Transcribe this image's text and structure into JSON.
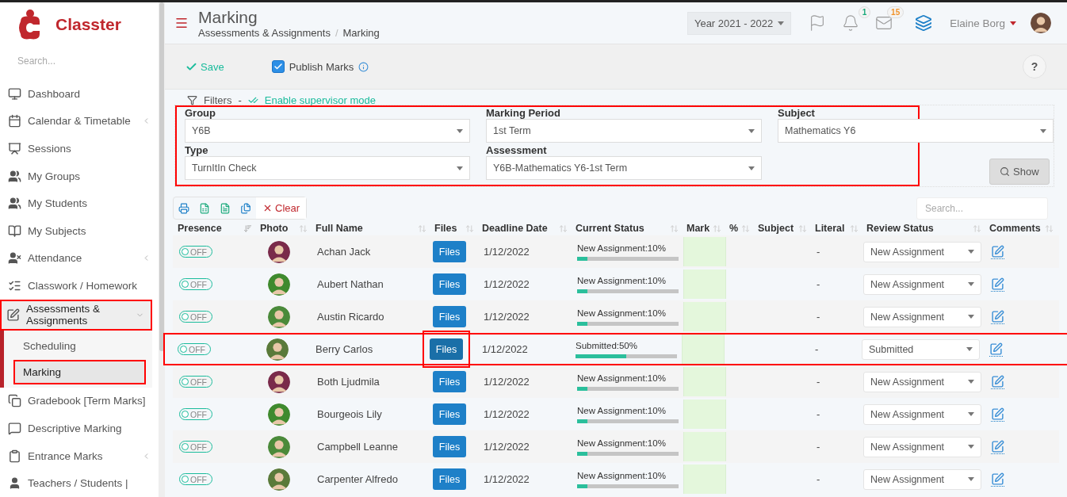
{
  "app": {
    "logo": "Classter"
  },
  "sidebar": {
    "search_placeholder": "Search...",
    "items": [
      {
        "label": "Dashboard",
        "kind": "link",
        "selected": false,
        "highlighted": false
      },
      {
        "label": "Calendar & Timetable",
        "kind": "group",
        "expanded": false,
        "selected": false,
        "highlighted": false
      },
      {
        "label": "Sessions",
        "kind": "link",
        "selected": false,
        "highlighted": false
      },
      {
        "label": "My Groups",
        "kind": "link",
        "selected": false,
        "highlighted": false
      },
      {
        "label": "My Students",
        "kind": "link",
        "selected": false,
        "highlighted": false
      },
      {
        "label": "My Subjects",
        "kind": "link",
        "selected": false,
        "highlighted": false
      },
      {
        "label": "Attendance",
        "kind": "group",
        "expanded": false,
        "selected": false,
        "highlighted": false
      },
      {
        "label": "Classwork / Homework",
        "kind": "link",
        "selected": false,
        "highlighted": false
      },
      {
        "label": "Assessments & Assignments",
        "kind": "group",
        "expanded": true,
        "selected": false,
        "highlighted": true,
        "children": [
          {
            "label": "Scheduling",
            "selected": false,
            "highlighted": false
          },
          {
            "label": "Marking",
            "selected": true,
            "highlighted": true
          }
        ]
      },
      {
        "label": "Gradebook [Term Marks]",
        "kind": "link",
        "selected": false,
        "highlighted": false
      },
      {
        "label": "Descriptive Marking",
        "kind": "link",
        "selected": false,
        "highlighted": false
      },
      {
        "label": "Entrance Marks",
        "kind": "group",
        "expanded": false,
        "selected": false,
        "highlighted": false
      },
      {
        "label": "Teachers / Students |",
        "kind": "link",
        "selected": false,
        "highlighted": false
      }
    ]
  },
  "header": {
    "title": "Marking",
    "breadcrumb": [
      "Assessments & Assignments",
      "Marking"
    ],
    "breadcrumb_separator": "/",
    "year": "Year 2021 - 2022",
    "notifications": "1",
    "messages": "15",
    "user": "Elaine Borg"
  },
  "toolbar": {
    "save": "Save",
    "publish": {
      "label": "Publish Marks",
      "checked": true
    },
    "help": "?"
  },
  "filters": {
    "title": "Filters",
    "separator": "-",
    "supervisor": "Enable supervisor mode",
    "highlighted": true,
    "fields": [
      {
        "label": "Group",
        "value": "Y6B"
      },
      {
        "label": "Marking Period",
        "value": "1st Term"
      },
      {
        "label": "Subject",
        "value": "Mathematics Y6"
      },
      {
        "label": "Type",
        "value": "TurnItIn Check"
      },
      {
        "label": "Assessment",
        "value": "Y6B-Mathematics Y6-1st Term"
      }
    ],
    "show": "Show"
  },
  "table": {
    "clear": "Clear",
    "search_placeholder": "Search...",
    "columns": [
      "Presence",
      "Photo",
      "Full Name",
      "Files",
      "Deadline Date",
      "Current Status",
      "Mark",
      "%",
      "Subject",
      "Literal",
      "Review Status",
      "Comments"
    ],
    "rows": [
      {
        "presence": "OFF",
        "on": false,
        "name": "Achan Jack",
        "files": "Files",
        "deadline": "1/12/2022",
        "status": "New Assignment:10%",
        "level": 0.1,
        "literal": "-",
        "review": "New Assignment",
        "highlighted": false,
        "files_highlighted": false
      },
      {
        "presence": "OFF",
        "on": false,
        "name": "Aubert Nathan",
        "files": "Files",
        "deadline": "1/12/2022",
        "status": "New Assignment:10%",
        "level": 0.1,
        "literal": "-",
        "review": "New Assignment",
        "highlighted": false,
        "files_highlighted": false
      },
      {
        "presence": "OFF",
        "on": false,
        "name": "Austin Ricardo",
        "files": "Files",
        "deadline": "1/12/2022",
        "status": "New Assignment:10%",
        "level": 0.1,
        "literal": "-",
        "review": "New Assignment",
        "highlighted": false,
        "files_highlighted": false
      },
      {
        "presence": "OFF",
        "on": false,
        "name": "Berry Carlos",
        "files": "Files",
        "deadline": "1/12/2022",
        "status": "Submitted:50%",
        "level": 0.5,
        "literal": "-",
        "review": "Submitted",
        "highlighted": true,
        "files_highlighted": true
      },
      {
        "presence": "OFF",
        "on": false,
        "name": "Both Ljudmila",
        "files": "Files",
        "deadline": "1/12/2022",
        "status": "New Assignment:10%",
        "level": 0.1,
        "literal": "-",
        "review": "New Assignment",
        "highlighted": false,
        "files_highlighted": false
      },
      {
        "presence": "OFF",
        "on": false,
        "name": "Bourgeois Lily",
        "files": "Files",
        "deadline": "1/12/2022",
        "status": "New Assignment:10%",
        "level": 0.1,
        "literal": "-",
        "review": "New Assignment",
        "highlighted": false,
        "files_highlighted": false
      },
      {
        "presence": "OFF",
        "on": false,
        "name": "Campbell Leanne",
        "files": "Files",
        "deadline": "1/12/2022",
        "status": "New Assignment:10%",
        "level": 0.1,
        "literal": "-",
        "review": "New Assignment",
        "highlighted": false,
        "files_highlighted": false
      },
      {
        "presence": "OFF",
        "on": false,
        "name": "Carpenter Alfredo",
        "files": "Files",
        "deadline": "1/12/2022",
        "status": "New Assignment:10%",
        "level": 0.1,
        "literal": "-",
        "review": "New Assignment",
        "highlighted": false,
        "files_highlighted": false
      }
    ]
  }
}
